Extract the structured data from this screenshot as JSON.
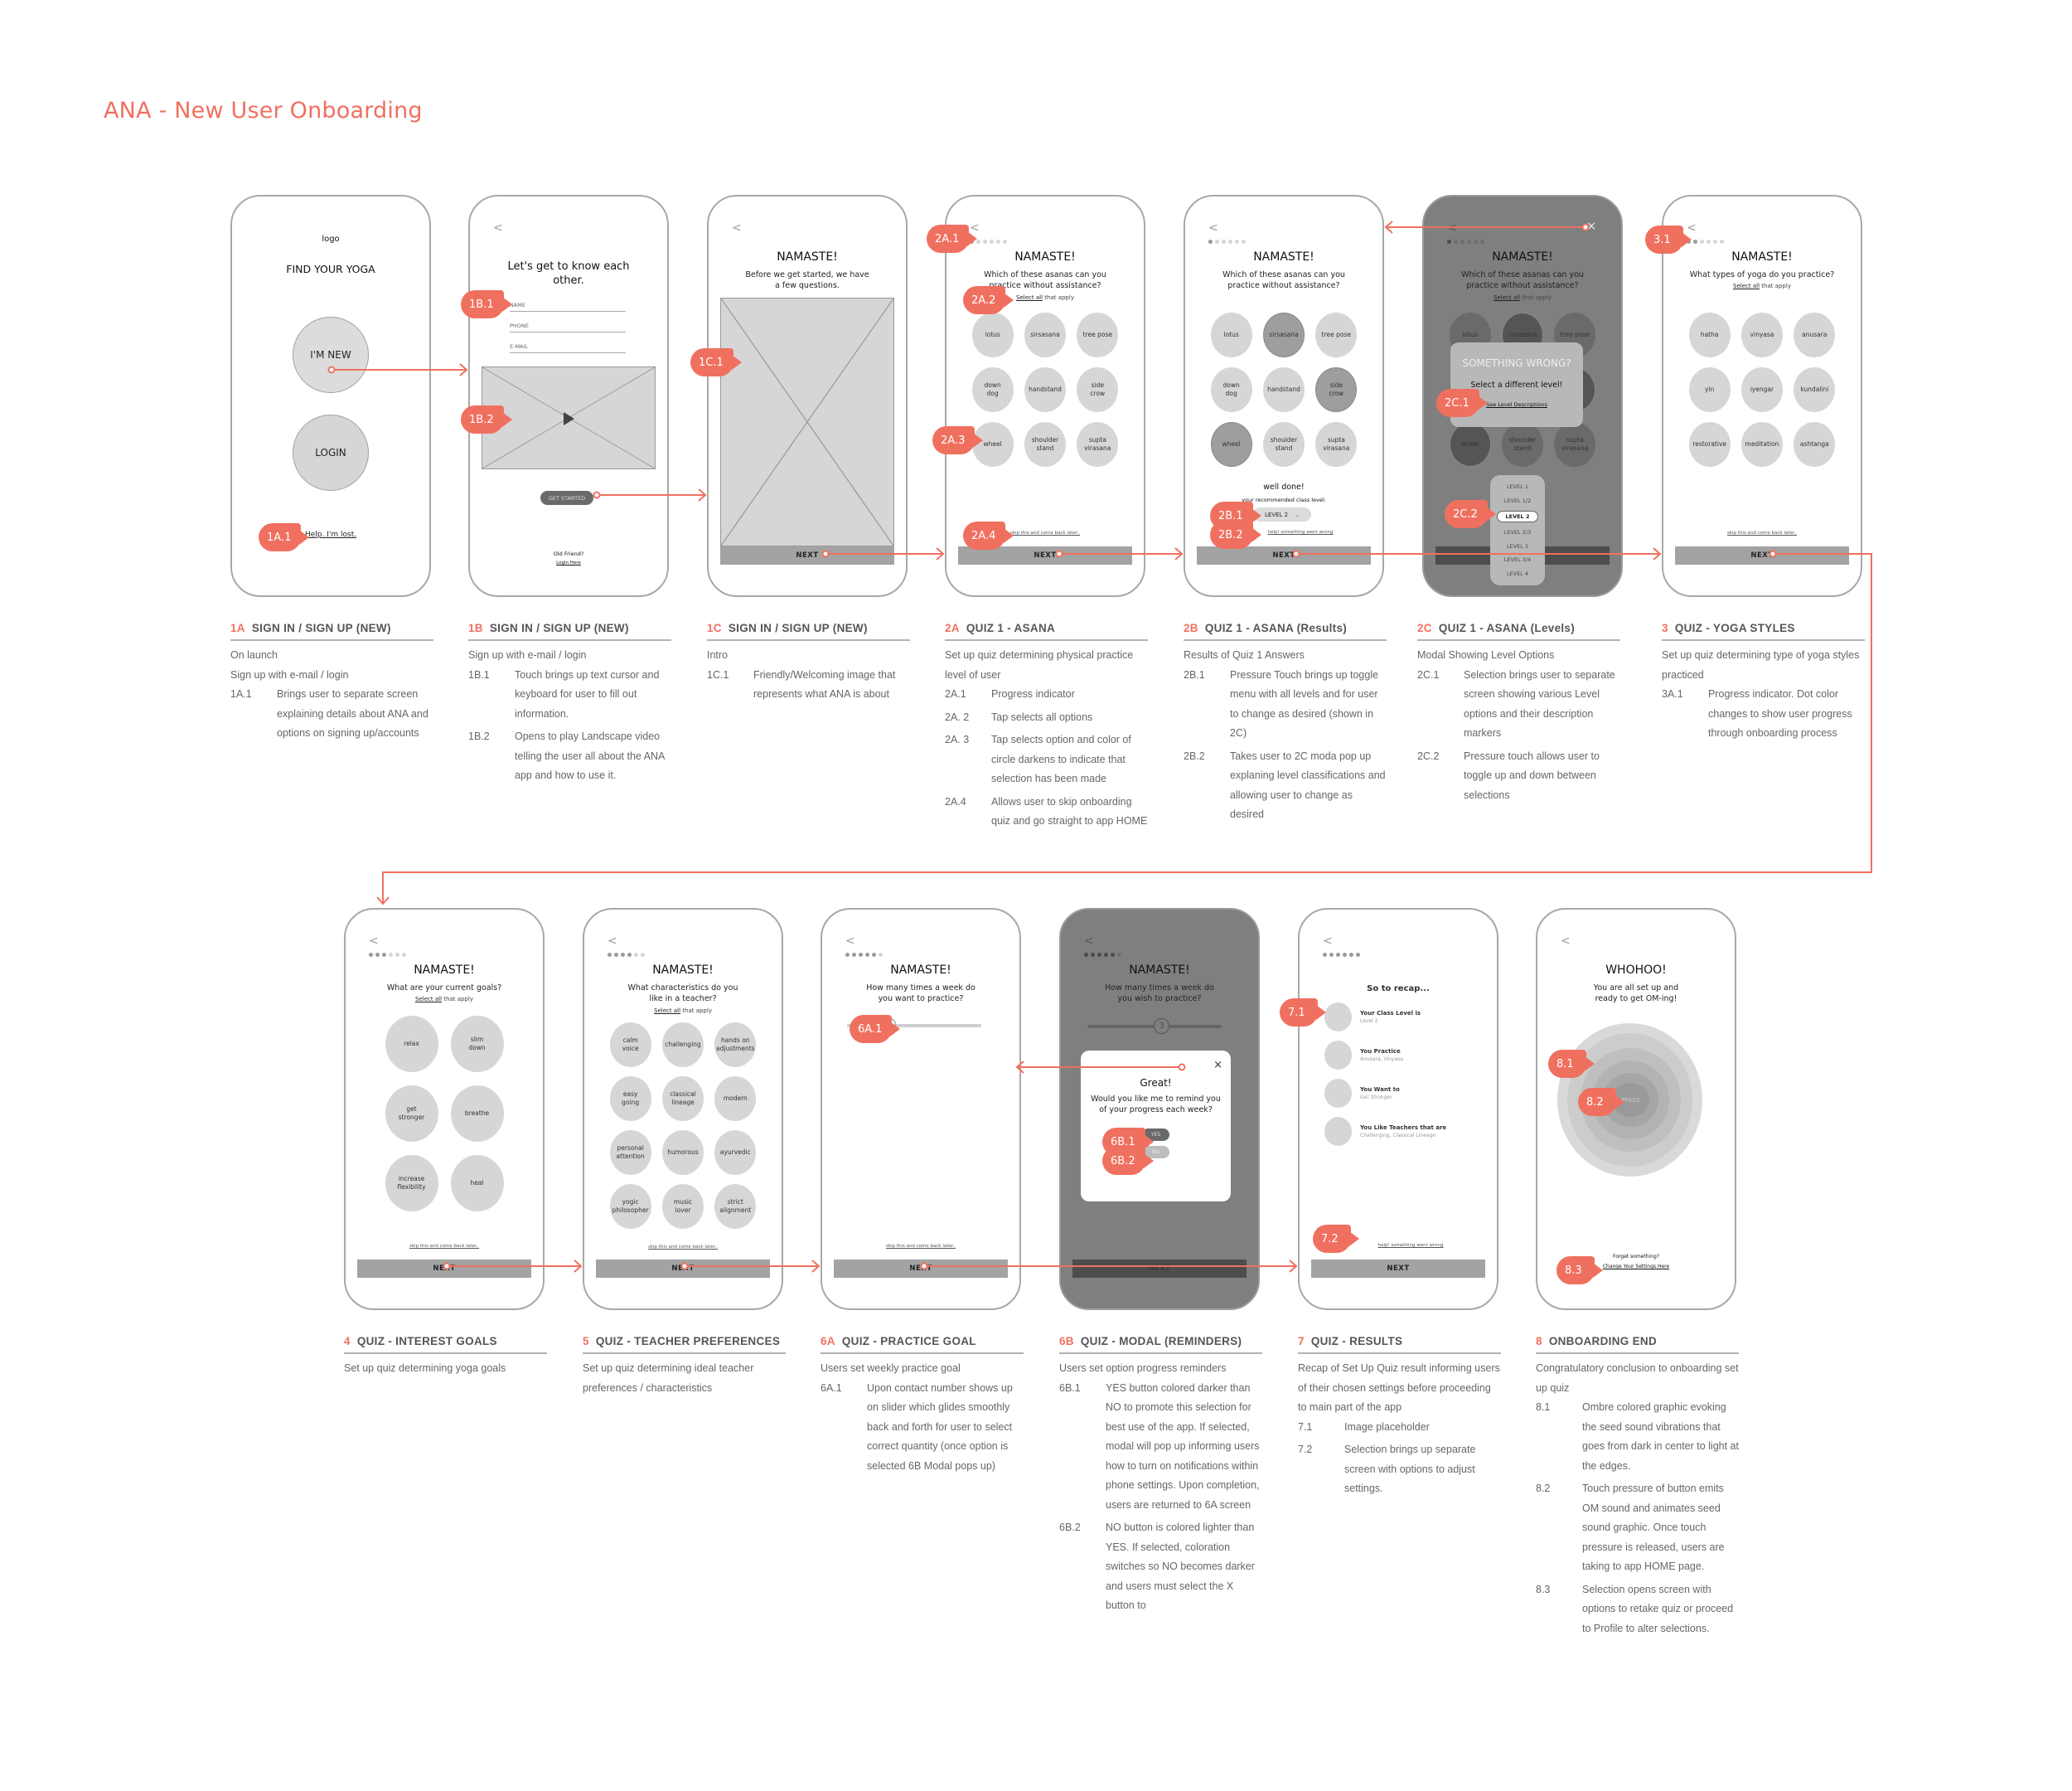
{
  "page_title": "ANA - New User Onboarding",
  "accent_color": "#f07060",
  "common": {
    "back_glyph": "<",
    "namaste": "NAMASTE!",
    "select_all_link": "Select all",
    "select_all_rest": " that apply",
    "next_label": "NEXT",
    "skip_link": "skip this and come back later.."
  },
  "screens": {
    "s1a": {
      "logo": "logo",
      "heading": "FIND YOUR YOGA",
      "new_button": "I'M NEW",
      "login_button": "LOGIN",
      "help_link": "Help. I'm lost.",
      "markers": [
        "1A.1"
      ]
    },
    "s1b": {
      "heading": "Let's get to know each other.",
      "fields": [
        {
          "placeholder": "NAME"
        },
        {
          "placeholder": "PHONE"
        },
        {
          "placeholder": "E-MAIL"
        }
      ],
      "video_icon": "play-icon",
      "cta": "GET STARTED",
      "footer_q": "Old Friend?",
      "footer_link": "Login Here",
      "markers": [
        "1B.1",
        "1B.2"
      ]
    },
    "s1c": {
      "subtitle": "Before we get started, we have a few questions.",
      "markers": [
        "1C.1"
      ]
    },
    "s2a": {
      "progress": {
        "current": 1,
        "total": 6
      },
      "question": "Which of these asanas can you practice without assistance?",
      "options": [
        "lotus",
        "sirsasana",
        "tree pose",
        "down\ndog",
        "handstand",
        "side\ncrow",
        "wheel",
        "shoulder\nstand",
        "supta\nvirasana"
      ],
      "markers": [
        "2A.1",
        "2A.2",
        "2A.3",
        "2A.4"
      ]
    },
    "s2b": {
      "progress": {
        "current": 1,
        "total": 6
      },
      "question": "Which of these asanas can you practice without assistance?",
      "options": [
        "lotus",
        "sirsasana",
        "tree pose",
        "down\ndog",
        "handstand",
        "side\ncrow",
        "wheel",
        "shoulder\nstand",
        "supta\nvirasana"
      ],
      "selected": [
        "sirsasana",
        "side\ncrow",
        "wheel"
      ],
      "well_done": "well done!",
      "recommended_label": "your recommended class level:",
      "level_value": "LEVEL 2",
      "help_link": "help! something went wrong",
      "markers": [
        "2B.1",
        "2B.2"
      ]
    },
    "s2c": {
      "progress": {
        "current": 1,
        "total": 6
      },
      "question": "Which of these asanas can you practice without assistance?",
      "modal_title": "SOMETHING WRONG?",
      "modal_text": "Select a different level!",
      "modal_link": "See Level Descriptions",
      "close_glyph": "×",
      "levels": [
        "LEVEL 1",
        "LEVEL 1/2",
        "LEVEL 2",
        "LEVEL 2/3",
        "LEVEL 3",
        "LEVEL 3/4",
        "LEVEL 4"
      ],
      "selected_level": "LEVEL 2",
      "markers": [
        "2C.1",
        "2C.2"
      ]
    },
    "s3": {
      "progress": {
        "current": 2,
        "total": 6
      },
      "question": "What types of yoga do you practice?",
      "options": [
        "hatha",
        "vinyasa",
        "anusara",
        "yin",
        "iyengar",
        "kundalini",
        "restorative",
        "meditation",
        "ashtanga"
      ],
      "markers": [
        "3.1"
      ]
    },
    "s4": {
      "progress": {
        "current": 3,
        "total": 6
      },
      "question": "What are your current goals?",
      "options": [
        "relax",
        "slim\ndown",
        "get\nstronger",
        "breathe",
        "increase\nflexibility",
        "heal"
      ]
    },
    "s5": {
      "progress": {
        "current": 4,
        "total": 6
      },
      "question": "What characteristics do you like in a teacher?",
      "options": [
        "calm\nvoice",
        "challenging",
        "hands on\nadjustments",
        "easy\ngoing",
        "classical\nlineage",
        "modern",
        "personal\nattention",
        "humorous",
        "ayurvedic",
        "yogic\nphilosopher",
        "music\nlover",
        "strict\nalignment"
      ]
    },
    "s6a": {
      "progress": {
        "current": 5,
        "total": 6
      },
      "question": "How many times a week do you want to practice?",
      "slider_value_fraction": 0.3,
      "markers": [
        "6A.1"
      ]
    },
    "s6b": {
      "progress": {
        "current": 5,
        "total": 6
      },
      "question": "How many times a week do you wish to practice?",
      "slider_value": "3",
      "slider_value_fraction": 0.55,
      "modal_title": "Great!",
      "modal_text": "Would you like me to remind you of your progress each week?",
      "yes_label": "YES",
      "no_label": "NO",
      "close_glyph": "×",
      "markers": [
        "6B.1",
        "6B.2"
      ]
    },
    "s7": {
      "progress": {
        "current": 6,
        "total": 6
      },
      "heading": "So to recap...",
      "recap": [
        {
          "label": "Your Class Level is",
          "value": "Level 2"
        },
        {
          "label": "You Practice",
          "value": "Anusara, Vinyasa"
        },
        {
          "label": "You Want to",
          "value": "Get Stronger"
        },
        {
          "label": "You Like Teachers that are",
          "value": "Challenging, Classical Lineage"
        }
      ],
      "help_link": "help! something went wrong",
      "markers": [
        "7.1",
        "7.2"
      ]
    },
    "s8": {
      "heading": "WHOHOO!",
      "subtitle": "You are all set up and ready to get OM-ing!",
      "press_label": "PRESS",
      "footer_q": "Forget something?",
      "footer_link": "Change Your Settings Here",
      "markers": [
        "8.1",
        "8.2",
        "8.3"
      ]
    }
  },
  "descriptions": [
    {
      "code": "1A",
      "title": "SIGN IN / SIGN UP (NEW)",
      "intro": [
        "On launch",
        "Sign up with e-mail / login"
      ],
      "items": [
        {
          "n": "1A.1",
          "t": "Brings user to separate screen explaining details about ANA and options on signing up/accounts"
        }
      ]
    },
    {
      "code": "1B",
      "title": "SIGN IN / SIGN UP (NEW)",
      "intro": [
        "Sign up with e-mail / login"
      ],
      "items": [
        {
          "n": "1B.1",
          "t": "Touch brings up text cursor and keyboard for user to fill out information."
        },
        {
          "n": "1B.2",
          "t": "Opens to play Landscape video telling the user all about the ANA app and how to use it."
        }
      ]
    },
    {
      "code": "1C",
      "title": "SIGN IN / SIGN UP (NEW)",
      "intro": [
        "Intro"
      ],
      "items": [
        {
          "n": "1C.1",
          "t": "Friendly/Welcoming image that represents what ANA is about"
        }
      ]
    },
    {
      "code": "2A",
      "title": "QUIZ 1 - ASANA",
      "intro": [
        "Set up quiz determining physical practice level of user"
      ],
      "items": [
        {
          "n": "2A.1",
          "t": "Progress indicator"
        },
        {
          "n": "2A. 2",
          "t": "Tap selects all options"
        },
        {
          "n": "2A. 3",
          "t": "Tap selects option and color of circle darkens to indicate that selection has been made"
        },
        {
          "n": "2A.4",
          "t": "Allows user to skip onboarding quiz and go straight to app HOME"
        }
      ]
    },
    {
      "code": "2B",
      "title": "QUIZ 1 - ASANA (Results)",
      "intro": [
        "Results of Quiz 1 Answers"
      ],
      "items": [
        {
          "n": "2B.1",
          "t": "Pressure Touch brings up toggle menu with all levels and for user to change as desired (shown in 2C)"
        },
        {
          "n": "2B.2",
          "t": "Takes user to 2C moda pop up explaning level classifications and allowing user to change as desired"
        }
      ]
    },
    {
      "code": "2C",
      "title": "QUIZ 1 - ASANA (Levels)",
      "intro": [
        "Modal Showing Level Options"
      ],
      "items": [
        {
          "n": "2C.1",
          "t": "Selection brings user to separate screen showing various Level options and their description markers"
        },
        {
          "n": "2C.2",
          "t": "Pressure touch allows user to toggle up and down between selections"
        }
      ]
    },
    {
      "code": "3",
      "title": "QUIZ - YOGA STYLES",
      "intro": [
        "Set up quiz determining type of yoga styles practiced"
      ],
      "items": [
        {
          "n": "3A.1",
          "t": "Progress indicator. Dot color changes to show user progress through onboarding process"
        }
      ]
    },
    {
      "code": "4",
      "title": "QUIZ - INTEREST GOALS",
      "intro": [
        "Set up quiz determining yoga goals"
      ],
      "items": []
    },
    {
      "code": "5",
      "title": "QUIZ - TEACHER PREFERENCES",
      "intro": [
        "Set up quiz determining ideal teacher preferences / characteristics"
      ],
      "items": []
    },
    {
      "code": "6A",
      "title": "QUIZ - PRACTICE GOAL",
      "intro": [
        "Users set weekly practice goal"
      ],
      "items": [
        {
          "n": "6A.1",
          "t": "Upon contact number shows up on slider which glides smoothly back and forth for user to select correct quantity (once option is selected 6B Modal pops up)"
        }
      ]
    },
    {
      "code": "6B",
      "title": "QUIZ - MODAL (REMINDERS)",
      "intro": [
        "Users set option progress reminders"
      ],
      "items": [
        {
          "n": "6B.1",
          "t": "YES button colored darker than NO to promote this selection for best use of the app. If selected, modal will pop up informing users how to turn on notifications within phone settings. Upon completion, users are returned to 6A screen"
        },
        {
          "n": "6B.2",
          "t": "NO button is colored lighter than YES. If selected, coloration switches so NO becomes darker and users must select the X button to"
        }
      ]
    },
    {
      "code": "7",
      "title": "QUIZ -  RESULTS",
      "intro": [
        "Recap of Set Up Quiz result informing users of their chosen settings before proceeding to main part of the app"
      ],
      "items": [
        {
          "n": "7.1",
          "t": "Image placeholder"
        },
        {
          "n": "7.2",
          "t": "Selection brings up separate screen with options to adjust settings."
        }
      ]
    },
    {
      "code": "8",
      "title": "ONBOARDING END",
      "intro": [
        "Congratulatory conclusion to onboarding set up quiz"
      ],
      "items": [
        {
          "n": "8.1",
          "t": "Ombre colored graphic evoking the seed sound vibrations that goes from dark in center to light at the edges."
        },
        {
          "n": "8.2",
          "t": "Touch pressure of button emits OM sound and animates seed sound graphic. Once touch pressure is released, users are taking to app HOME page."
        },
        {
          "n": "8.3",
          "t": "Selection opens screen with options to retake quiz or proceed to Profile to alter selections."
        }
      ]
    }
  ]
}
